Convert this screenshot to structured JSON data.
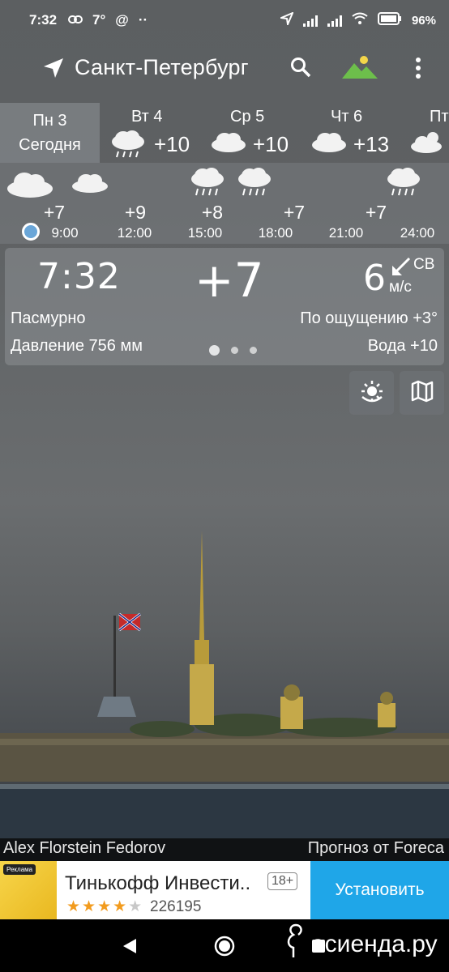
{
  "status_bar": {
    "time": "7:32",
    "temp": "7°",
    "at_sign": "@",
    "more": "··",
    "battery": "96%"
  },
  "app_bar": {
    "city": "Санкт-Петербург"
  },
  "days": {
    "today": {
      "name": "Пн 3",
      "label": "Сегодня"
    },
    "items": [
      {
        "name": "Вт 4",
        "temp": "+10",
        "icon": "rain-icon"
      },
      {
        "name": "Ср 5",
        "temp": "+10",
        "icon": "cloud-icon"
      },
      {
        "name": "Чт 6",
        "temp": "+13",
        "icon": "cloud-icon"
      },
      {
        "name": "Пт",
        "temp": "",
        "icon": "sun-cloud-icon"
      }
    ]
  },
  "hourly": [
    {
      "time": "9:00",
      "temp": "+7",
      "icon": "cloud-icon"
    },
    {
      "time": "12:00",
      "temp": "+9",
      "icon": "cloud-icon"
    },
    {
      "time": "15:00",
      "temp": "+8",
      "icon": "rain-icon"
    },
    {
      "time": "18:00",
      "temp": "+7",
      "icon": "rain-icon"
    },
    {
      "time": "21:00",
      "temp": "+7",
      "icon": ""
    },
    {
      "time": "24:00",
      "temp": "",
      "icon": "rain-icon"
    }
  ],
  "current": {
    "time": "7:32",
    "temp": "+7",
    "wind_speed": "6",
    "wind_dir": "СВ",
    "wind_unit": "м/с",
    "description": "Пасмурно",
    "feels_like": "По ощущению +3°",
    "pressure": "Давление 756 мм",
    "water": "Вода +10"
  },
  "credits": {
    "author": "Alex Florstein Fedorov",
    "source": "Прогноз от Foreca"
  },
  "ad": {
    "badge": "Реклама",
    "title": "Тинькофф Инвести..",
    "age": "18+",
    "rating": 4,
    "reviews": "226195",
    "install_label": "Установить"
  },
  "watermark": "асиенда.ру"
}
